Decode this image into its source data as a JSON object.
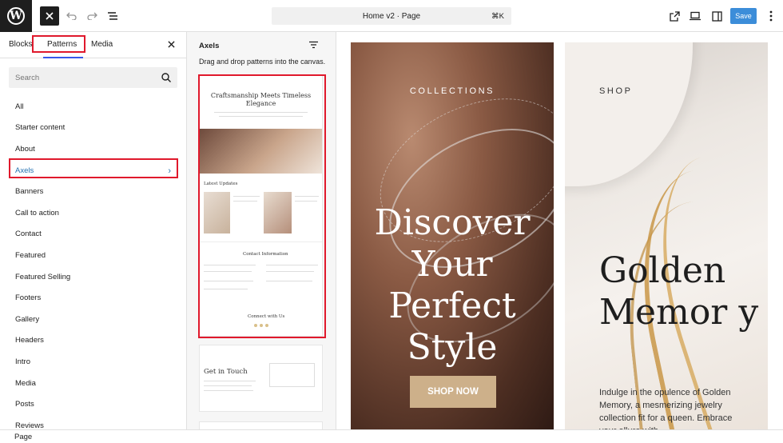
{
  "topbar": {
    "document_title": "Home v2 · Page",
    "shortcut": "⌘K",
    "save_label": "Save"
  },
  "inserter": {
    "tabs": [
      {
        "label": "Blocks"
      },
      {
        "label": "Patterns",
        "active": true
      },
      {
        "label": "Media"
      }
    ],
    "search_placeholder": "Search",
    "categories": [
      {
        "label": "All"
      },
      {
        "label": "Starter content"
      },
      {
        "label": "About"
      },
      {
        "label": "Axels",
        "active": true
      },
      {
        "label": "Banners"
      },
      {
        "label": "Call to action"
      },
      {
        "label": "Contact"
      },
      {
        "label": "Featured"
      },
      {
        "label": "Featured Selling"
      },
      {
        "label": "Footers"
      },
      {
        "label": "Gallery"
      },
      {
        "label": "Headers"
      },
      {
        "label": "Intro"
      },
      {
        "label": "Media"
      },
      {
        "label": "Posts"
      },
      {
        "label": "Reviews"
      }
    ]
  },
  "pattern_panel": {
    "title": "Axels",
    "description": "Drag and drop patterns into the canvas.",
    "preview1": {
      "title": "Craftsmanship Meets Timeless Elegance",
      "latest_updates": "Latest Updates",
      "contact_information": "Contact Information",
      "connect": "Connect with Us"
    },
    "preview2": {
      "title": "Get in Touch"
    }
  },
  "canvas": {
    "left": {
      "eyebrow": "COLLECTIONS",
      "heading": "Discover Your Perfect Style",
      "button": "SHOP NOW"
    },
    "right": {
      "eyebrow": "SHOP",
      "heading": "Golden Memor y",
      "body": "Indulge in the opulence of Golden Memory, a mesmerizing jewelry collection fit for a queen. Embrace your allure with"
    }
  },
  "footer": {
    "label": "Page"
  },
  "colors": {
    "accent": "#3c8dd9",
    "highlight": "#e0192c",
    "active_category": "#2271b1",
    "shop_button": "#cdb08a"
  }
}
